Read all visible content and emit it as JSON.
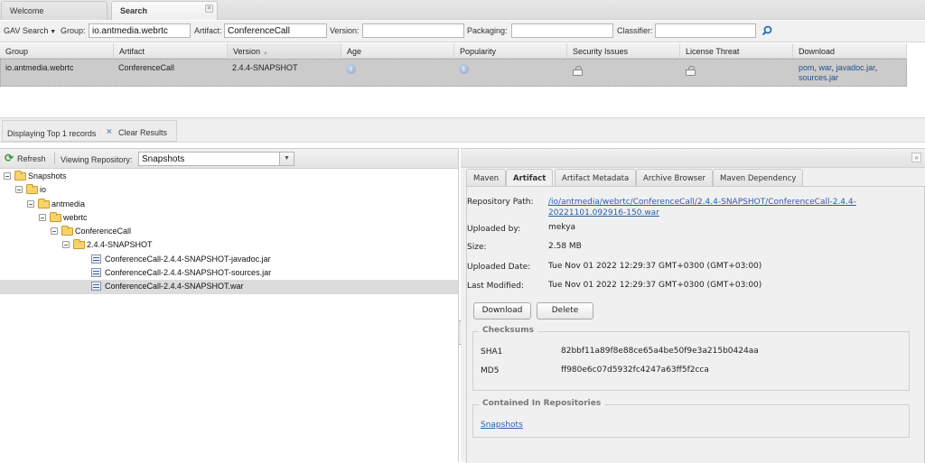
{
  "tabs": [
    {
      "label": "Welcome"
    },
    {
      "label": "Search",
      "active": true,
      "close_icon": "close-icon"
    }
  ],
  "search_toolbar": {
    "mode_label": "GAV Search",
    "group": {
      "label": "Group:",
      "value": "io.antmedia.webrtc"
    },
    "artifact": {
      "label": "Artifact:",
      "value": "ConferenceCall"
    },
    "version": {
      "label": "Version:",
      "value": ""
    },
    "packaging": {
      "label": "Packaging:",
      "value": ""
    },
    "classifier": {
      "label": "Classifier:",
      "value": ""
    },
    "search_icon": "magnifier-icon"
  },
  "results_grid": {
    "columns": [
      "Group",
      "Artifact",
      "Version",
      "Age",
      "Popularity",
      "Security Issues",
      "License Threat",
      "Download"
    ],
    "sorted_column": "Version",
    "sort_direction": "ascending",
    "rows": [
      {
        "group": "io.antmedia.webrtc",
        "artifact": "ConferenceCall",
        "version": "2.4.4-SNAPSHOT",
        "age_icon": "info-icon",
        "popularity_icon": "info-icon",
        "security_icon": "lock-icon",
        "license_icon": "lock-icon",
        "download_links": [
          "pom",
          "war",
          "javadoc.jar",
          "sources.jar"
        ]
      }
    ]
  },
  "status": {
    "text": "Displaying Top 1 records",
    "clear_label": "Clear Results"
  },
  "repo_browser": {
    "refresh_label": "Refresh",
    "viewing_label": "Viewing Repository:",
    "selected_repo": "Snapshots",
    "tree": [
      {
        "label": "Snapshots",
        "type": "folder",
        "depth": 0
      },
      {
        "label": "io",
        "type": "folder",
        "depth": 1
      },
      {
        "label": "antmedia",
        "type": "folder",
        "depth": 2
      },
      {
        "label": "webrtc",
        "type": "folder",
        "depth": 3
      },
      {
        "label": "ConferenceCall",
        "type": "folder",
        "depth": 4
      },
      {
        "label": "2.4.4-SNAPSHOT",
        "type": "folder",
        "depth": 5
      },
      {
        "label": "ConferenceCall-2.4.4-SNAPSHOT-javadoc.jar",
        "type": "file",
        "depth": 6
      },
      {
        "label": "ConferenceCall-2.4.4-SNAPSHOT-sources.jar",
        "type": "file",
        "depth": 6
      },
      {
        "label": "ConferenceCall-2.4.4-SNAPSHOT.war",
        "type": "file",
        "depth": 6,
        "selected": true
      }
    ]
  },
  "detail_panel": {
    "tabs": [
      "Maven",
      "Artifact",
      "Artifact Metadata",
      "Archive Browser",
      "Maven Dependency"
    ],
    "active_tab": "Artifact",
    "fields": {
      "repository_path": {
        "label": "Repository Path:",
        "value": "/io/antmedia/webrtc/ConferenceCall/2.4.4-SNAPSHOT/ConferenceCall-2.4.4-20221101.092916-150.war"
      },
      "uploaded_by": {
        "label": "Uploaded by:",
        "value": "mekya"
      },
      "size": {
        "label": "Size:",
        "value": "2.58 MB"
      },
      "uploaded_date": {
        "label": "Uploaded Date:",
        "value": "Tue Nov 01 2022 12:29:37 GMT+0300 (GMT+03:00)"
      },
      "last_modified": {
        "label": "Last Modified:",
        "value": "Tue Nov 01 2022 12:29:37 GMT+0300 (GMT+03:00)"
      }
    },
    "buttons": {
      "download": "Download",
      "delete": "Delete"
    },
    "checksums": {
      "title": "Checksums",
      "sha1": {
        "label": "SHA1",
        "value": "82bbf11a89f8e88ce65a4be50f9e3a215b0424aa"
      },
      "md5": {
        "label": "MD5",
        "value": "ff980e6c07d5932fc4247a63ff5f2cca"
      }
    },
    "contained_in": {
      "title": "Contained In Repositories",
      "repositories": [
        "Snapshots"
      ]
    }
  }
}
